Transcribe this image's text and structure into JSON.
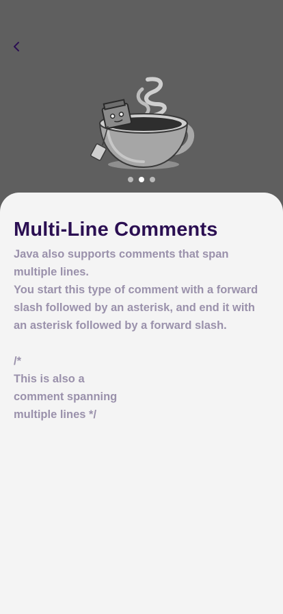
{
  "icons": {
    "back": "chevron-left-icon",
    "hero": "coffee-cup-with-robot-illustration"
  },
  "colors": {
    "title": "#2b0f52",
    "body": "#9a91ab",
    "overlay": "#5f5f5f",
    "sheet": "#f4f4f4"
  },
  "pager": {
    "count": 3,
    "active_index": 1
  },
  "lesson": {
    "title": "Multi-Line Comments",
    "body": "Java also supports comments that span\nmultiple lines.\nYou start this type of comment with a forward\nslash followed by an asterisk, and end it with\nan asterisk followed by a forward slash.\n\n/*\nThis is also a\ncomment spanning\nmultiple lines */"
  }
}
